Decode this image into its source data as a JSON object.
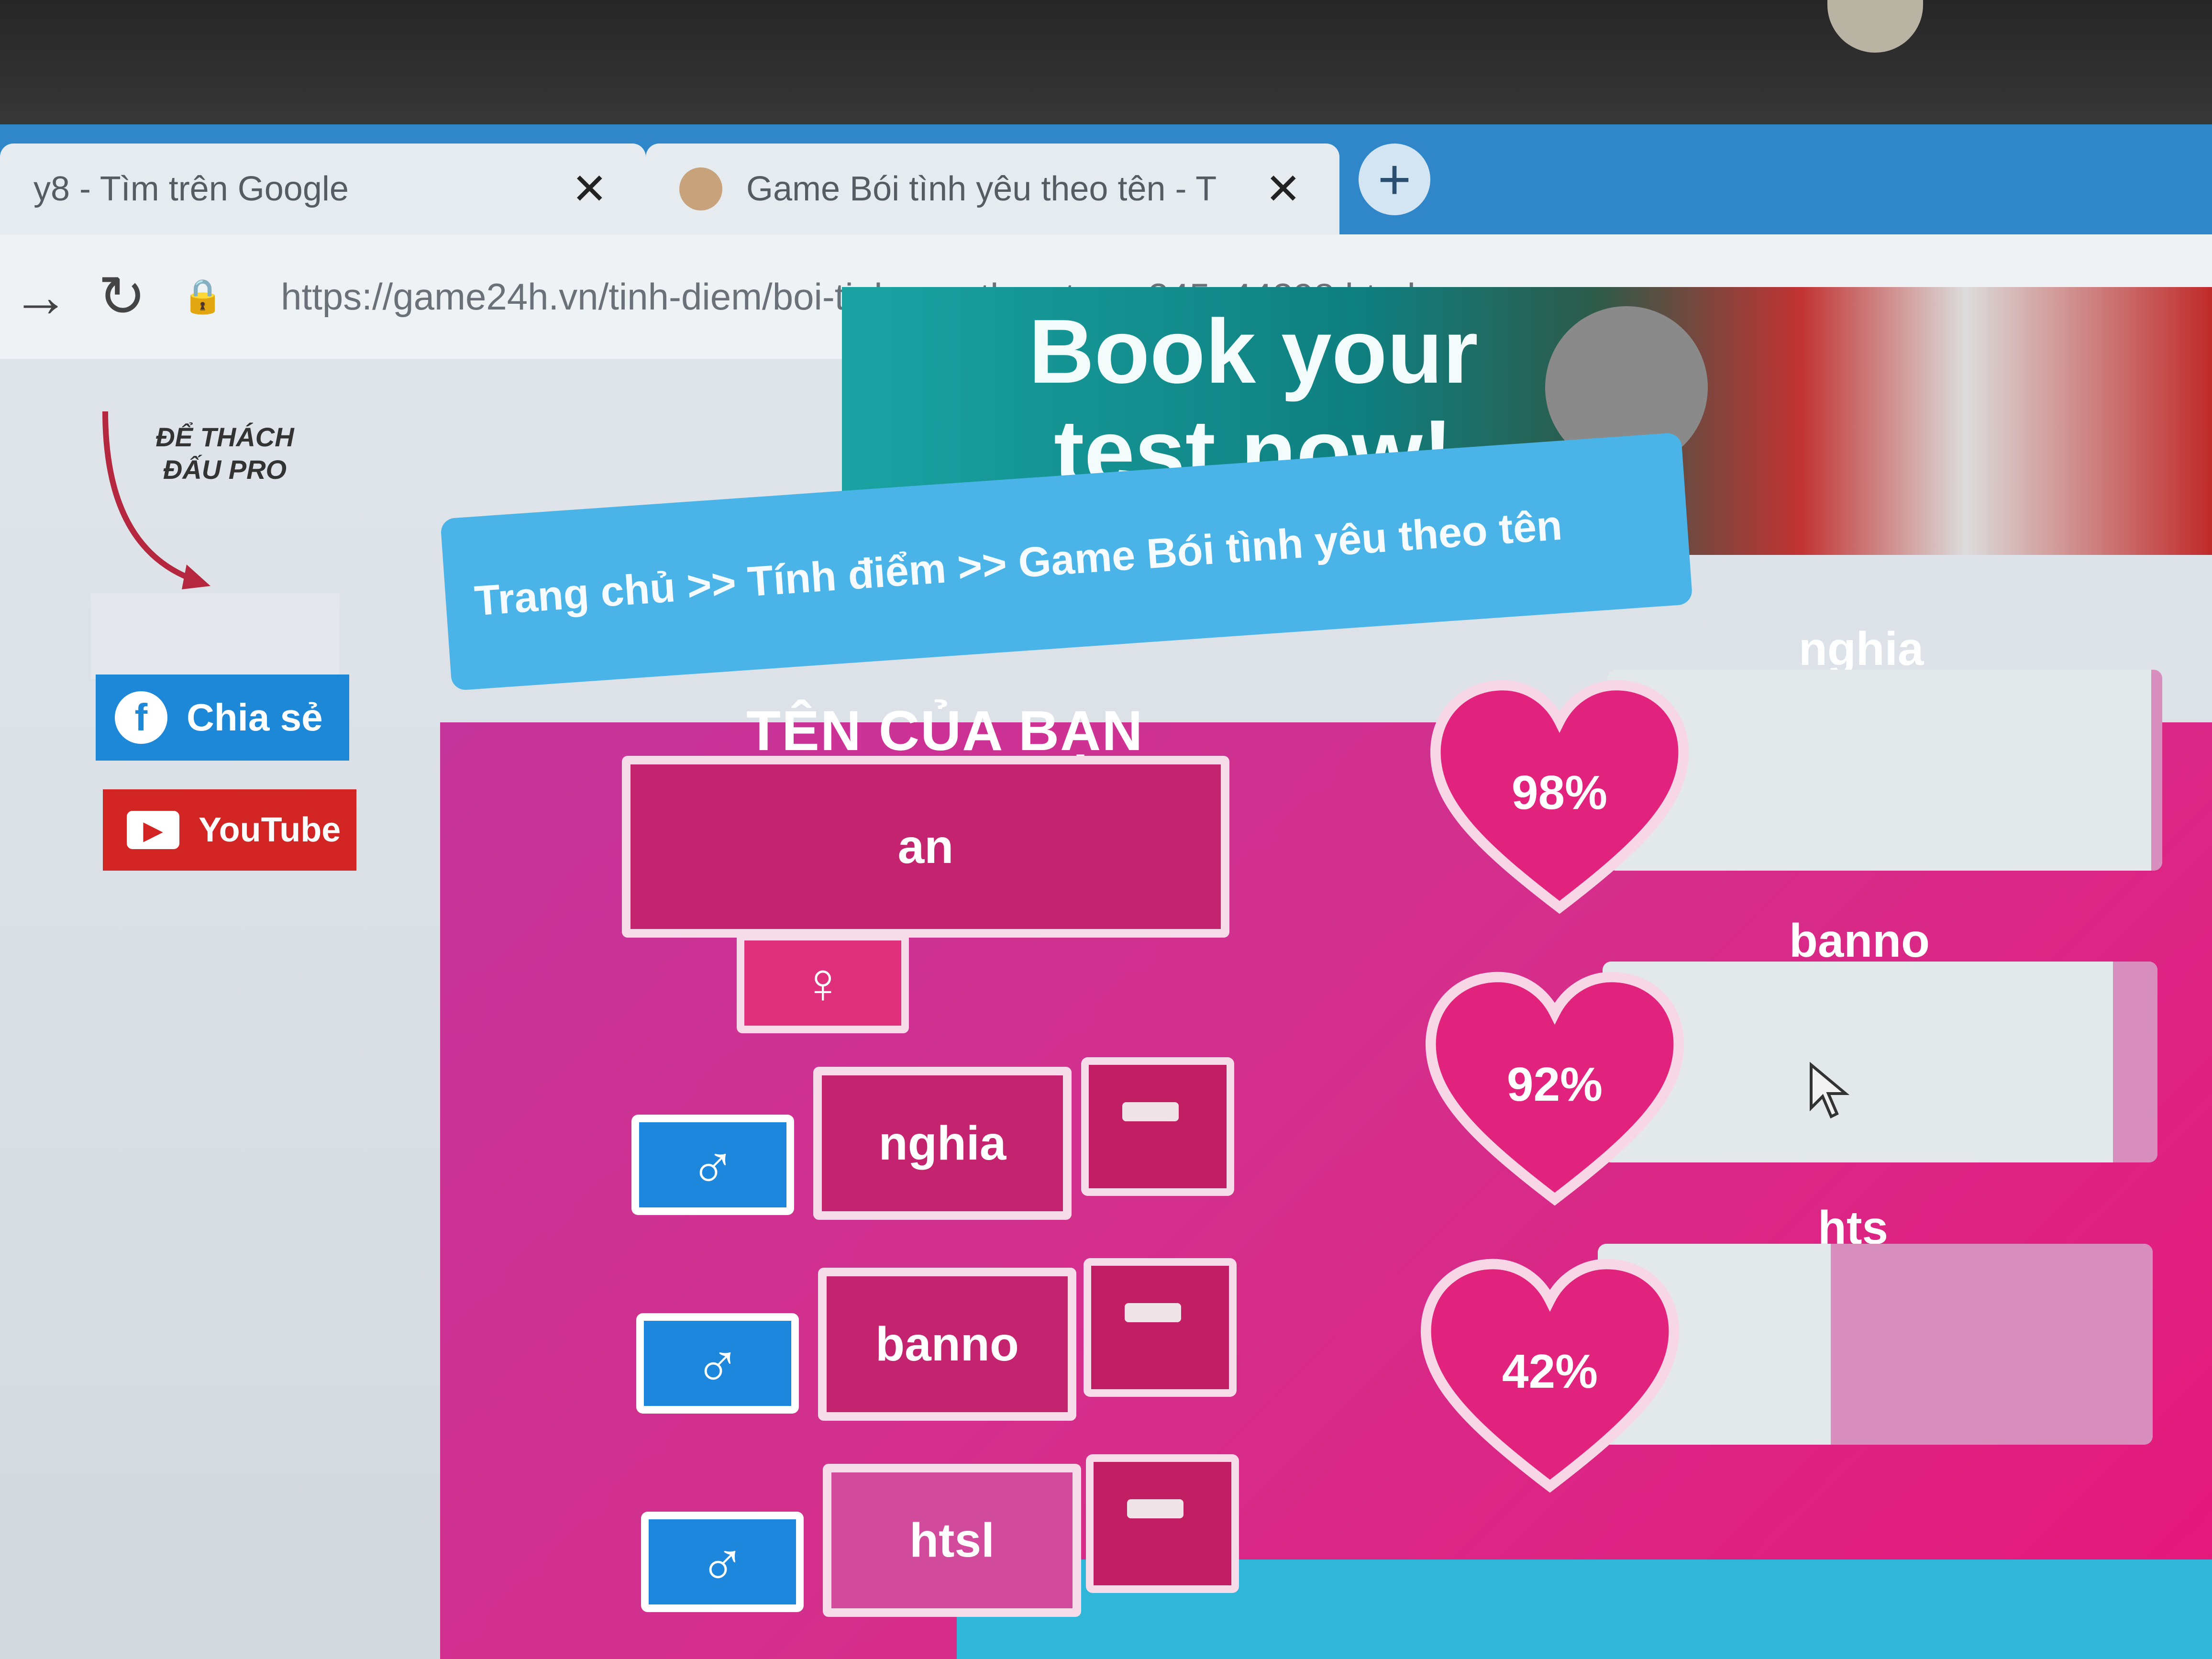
{
  "browser": {
    "tabs": [
      {
        "label": "y8 - Tìm trên Google"
      },
      {
        "label": "Game Bói tình yêu theo tên - T"
      }
    ],
    "new_tab": "+",
    "url": "https://game24h.vn/tinh-diem/boi-tinh-yeu-theo-ten-c245g44298.html"
  },
  "banner": {
    "line1": "Book your",
    "line2": "test now!"
  },
  "logo": {
    "text": "ĐỂ THÁCH ĐẤU PRO"
  },
  "sidebar": {
    "share_label": "Chia sẻ",
    "youtube_label": "YouTube"
  },
  "breadcrumb": {
    "text": "Trang chủ >> Tính điểm >> Game Bói tình yêu theo tên"
  },
  "game": {
    "title": "TÊN CỦA BẠN",
    "your_name": "an",
    "your_gender_symbol": "♀",
    "partners": [
      {
        "name": "nghia",
        "gender_symbol": "♂",
        "percent_label": "98%",
        "percent": 98
      },
      {
        "name": "banno",
        "gender_symbol": "♂",
        "percent_label": "92%",
        "percent": 92
      },
      {
        "name": "hts",
        "gender_symbol": "♂",
        "percent_label": "42%",
        "percent": 42
      }
    ],
    "typing_name": "htsl",
    "colors": {
      "panel": "#d42f8c",
      "male": "#1c87dd",
      "heart": "#e2237d"
    }
  }
}
